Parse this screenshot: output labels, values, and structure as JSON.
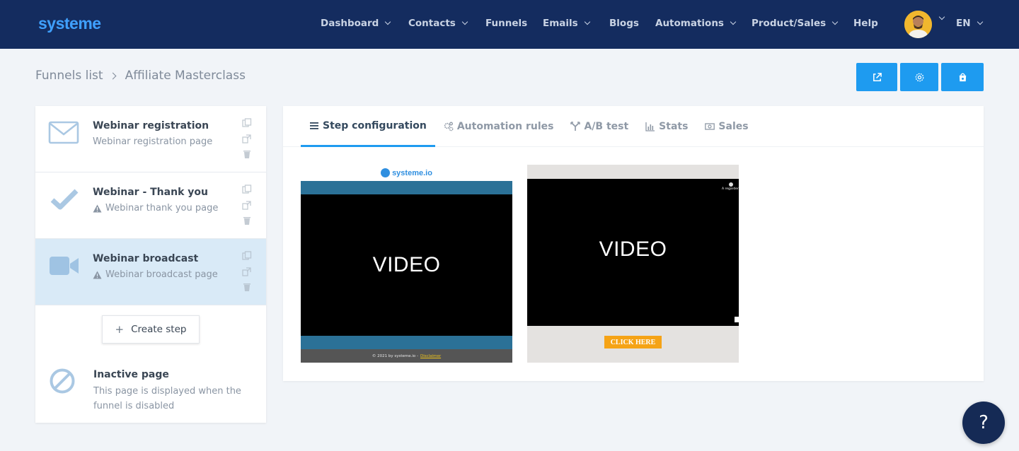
{
  "brand": {
    "logo": "systeme",
    "accent": "#1e9bf0",
    "nav_bg": "#142c5f"
  },
  "nav": {
    "items": [
      {
        "label": "Dashboard",
        "dropdown": true
      },
      {
        "label": "Contacts",
        "dropdown": true
      },
      {
        "label": "Funnels",
        "dropdown": false
      },
      {
        "label": "Emails",
        "dropdown": true
      },
      {
        "label": "Blogs",
        "dropdown": false
      },
      {
        "label": "Automations",
        "dropdown": true
      },
      {
        "label": "Product/Sales",
        "dropdown": true
      },
      {
        "label": "Help",
        "dropdown": false
      }
    ],
    "language": "EN"
  },
  "breadcrumb": {
    "parent": "Funnels list",
    "current": "Affiliate Masterclass"
  },
  "actions": [
    "external-link-icon",
    "gear-icon",
    "shop-icon"
  ],
  "steps": [
    {
      "title": "Webinar registration",
      "subtitle": "Webinar registration page",
      "icon": "envelope-icon",
      "warning": false,
      "active": false
    },
    {
      "title": "Webinar - Thank you",
      "subtitle": "Webinar thank you page",
      "icon": "checkmark-icon",
      "warning": true,
      "active": false
    },
    {
      "title": "Webinar broadcast",
      "subtitle": "Webinar broadcast page",
      "icon": "video-camera-icon",
      "warning": true,
      "active": true
    }
  ],
  "create_step": {
    "label": "Create step"
  },
  "inactive": {
    "title": "Inactive page",
    "description": "This page is displayed when the funnel is disabled"
  },
  "tabs": [
    {
      "label": "Step configuration",
      "icon": "list-icon",
      "active": true
    },
    {
      "label": "Automation rules",
      "icon": "gears-icon",
      "active": false
    },
    {
      "label": "A/B test",
      "icon": "split-icon",
      "active": false
    },
    {
      "label": "Stats",
      "icon": "bar-chart-icon",
      "active": false
    },
    {
      "label": "Sales",
      "icon": "money-icon",
      "active": false
    }
  ],
  "previews": {
    "first": {
      "logo": "systeme.io",
      "video": "VIDEO",
      "footer": "© 2021 by systeme.io -",
      "footer_link": "Disclaimer"
    },
    "second": {
      "video": "VIDEO",
      "top_label": "A regarder",
      "cta": "CLICK HERE"
    }
  },
  "help": {
    "label": "?"
  }
}
